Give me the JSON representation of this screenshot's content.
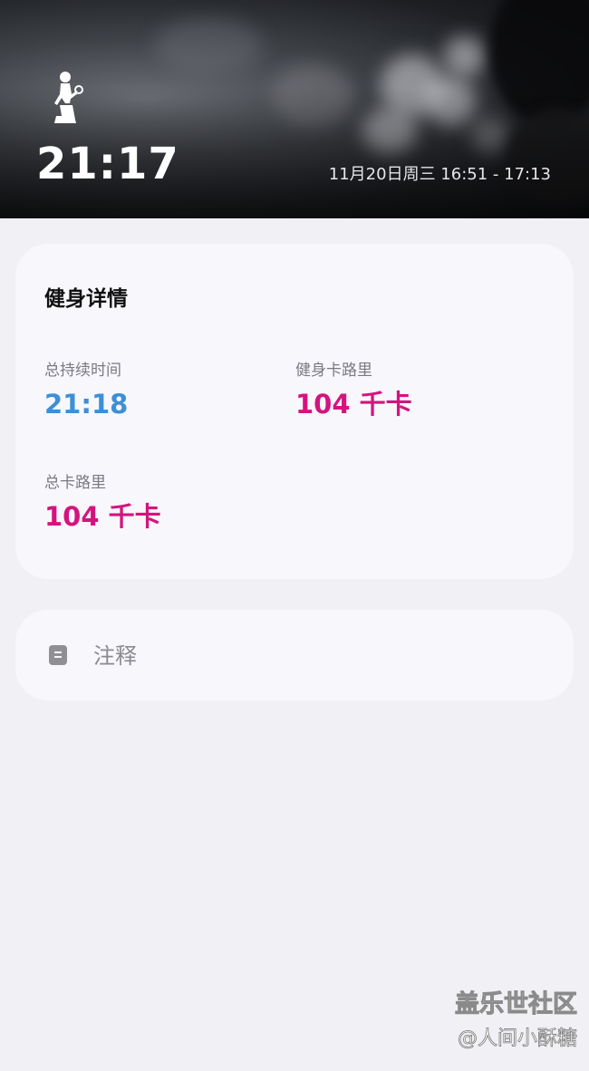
{
  "hero": {
    "activity_icon": "exercise-figure-icon",
    "duration": "21:17",
    "time_range": "11月20日周三 16:51 - 17:13"
  },
  "details": {
    "title": "健身详情",
    "total_duration_label": "总持续时间",
    "total_duration_value": "21:18",
    "workout_calories_label": "健身卡路里",
    "workout_calories_value": "104 千卡",
    "total_calories_label": "总卡路里",
    "total_calories_value": "104 千卡"
  },
  "notes": {
    "icon": "note-icon",
    "label": "注释"
  },
  "watermark": {
    "line1": "盖乐世社区",
    "line2": "@人间小酥糖"
  },
  "colors": {
    "background": "#f1f0f5",
    "card": "#f8f7fc",
    "duration_blue": "#3c8fd8",
    "calorie_pink": "#d4147e"
  }
}
